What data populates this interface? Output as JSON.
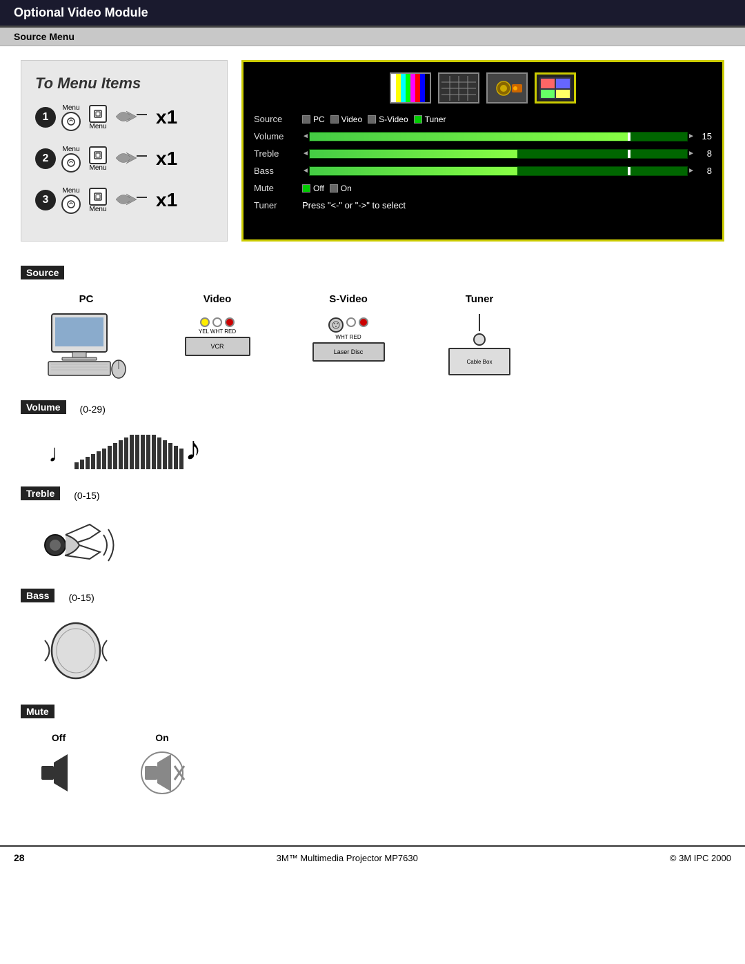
{
  "header": {
    "title": "Optional Video Module"
  },
  "section_header": {
    "title": "Source Menu"
  },
  "menu_steps": {
    "title": "To Menu Items",
    "steps": [
      {
        "number": "1",
        "x_label": "x1"
      },
      {
        "number": "2",
        "x_label": "x1"
      },
      {
        "number": "3",
        "x_label": "x1"
      }
    ],
    "button_label": "Menu"
  },
  "source_menu": {
    "rows": [
      {
        "label": "Source",
        "type": "radio",
        "options": [
          "PC",
          "Video",
          "S-Video",
          "Tuner"
        ],
        "active": "Tuner"
      },
      {
        "label": "Volume",
        "type": "slider",
        "value": 15
      },
      {
        "label": "Treble",
        "type": "slider",
        "value": 8
      },
      {
        "label": "Bass",
        "type": "slider",
        "value": 8
      },
      {
        "label": "Mute",
        "type": "radio2",
        "options": [
          "Off",
          "On"
        ],
        "active": "Off"
      },
      {
        "label": "Tuner",
        "type": "text",
        "value": "Press \"<-\" or \"->\" to select"
      }
    ]
  },
  "source_section": {
    "label": "Source",
    "items": [
      {
        "label": "PC"
      },
      {
        "label": "Video"
      },
      {
        "label": "S-Video"
      },
      {
        "label": "Tuner"
      }
    ]
  },
  "volume_section": {
    "label": "Volume",
    "range": "(0-29)"
  },
  "treble_section": {
    "label": "Treble",
    "range": "(0-15)"
  },
  "bass_section": {
    "label": "Bass",
    "range": "(0-15)"
  },
  "mute_section": {
    "label": "Mute",
    "items": [
      {
        "label": "Off"
      },
      {
        "label": "On"
      }
    ]
  },
  "footer": {
    "page_number": "28",
    "center_text": "3M™ Multimedia Projector MP7630",
    "right_text": "© 3M IPC 2000"
  },
  "icons": {
    "vcr_label": "VCR",
    "laser_disc_label": "Laser Disc",
    "cable_box_label": "Cable Box",
    "yel_wht_red": "YEL WHT RED",
    "wht_red": "WHT RED"
  }
}
